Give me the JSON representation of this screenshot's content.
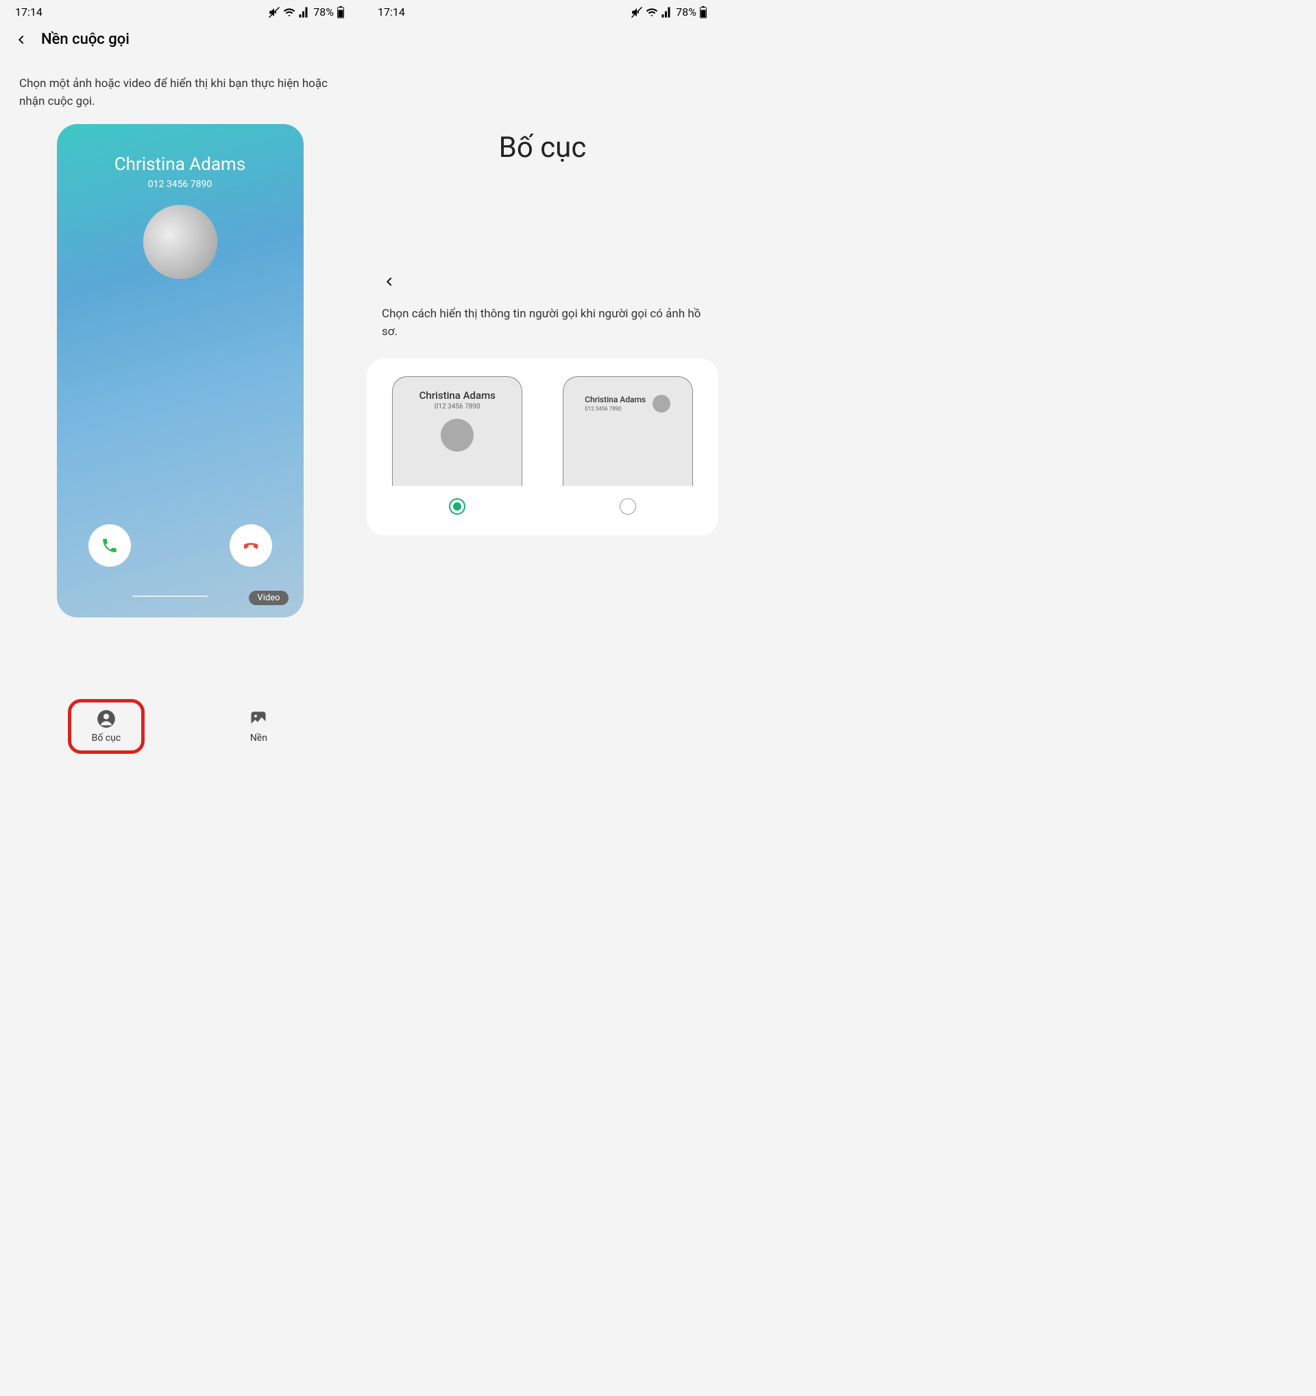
{
  "status": {
    "time": "17:14",
    "battery": "78%"
  },
  "left": {
    "title": "Nền cuộc gọi",
    "description": "Chọn một ảnh hoặc video để hiển thị khi bạn thực hiện hoặc nhận cuộc gọi.",
    "caller_name": "Christina Adams",
    "caller_number": "012 3456 7890",
    "video_badge": "Video",
    "tabs": {
      "layout": "Bố cục",
      "background": "Nền"
    }
  },
  "right": {
    "big_title": "Bố cục",
    "description": "Chọn cách hiển thị thông tin người gọi khi người gọi có ảnh hồ sơ.",
    "option_name": "Christina Adams",
    "option_number": "012 3456 7890"
  }
}
